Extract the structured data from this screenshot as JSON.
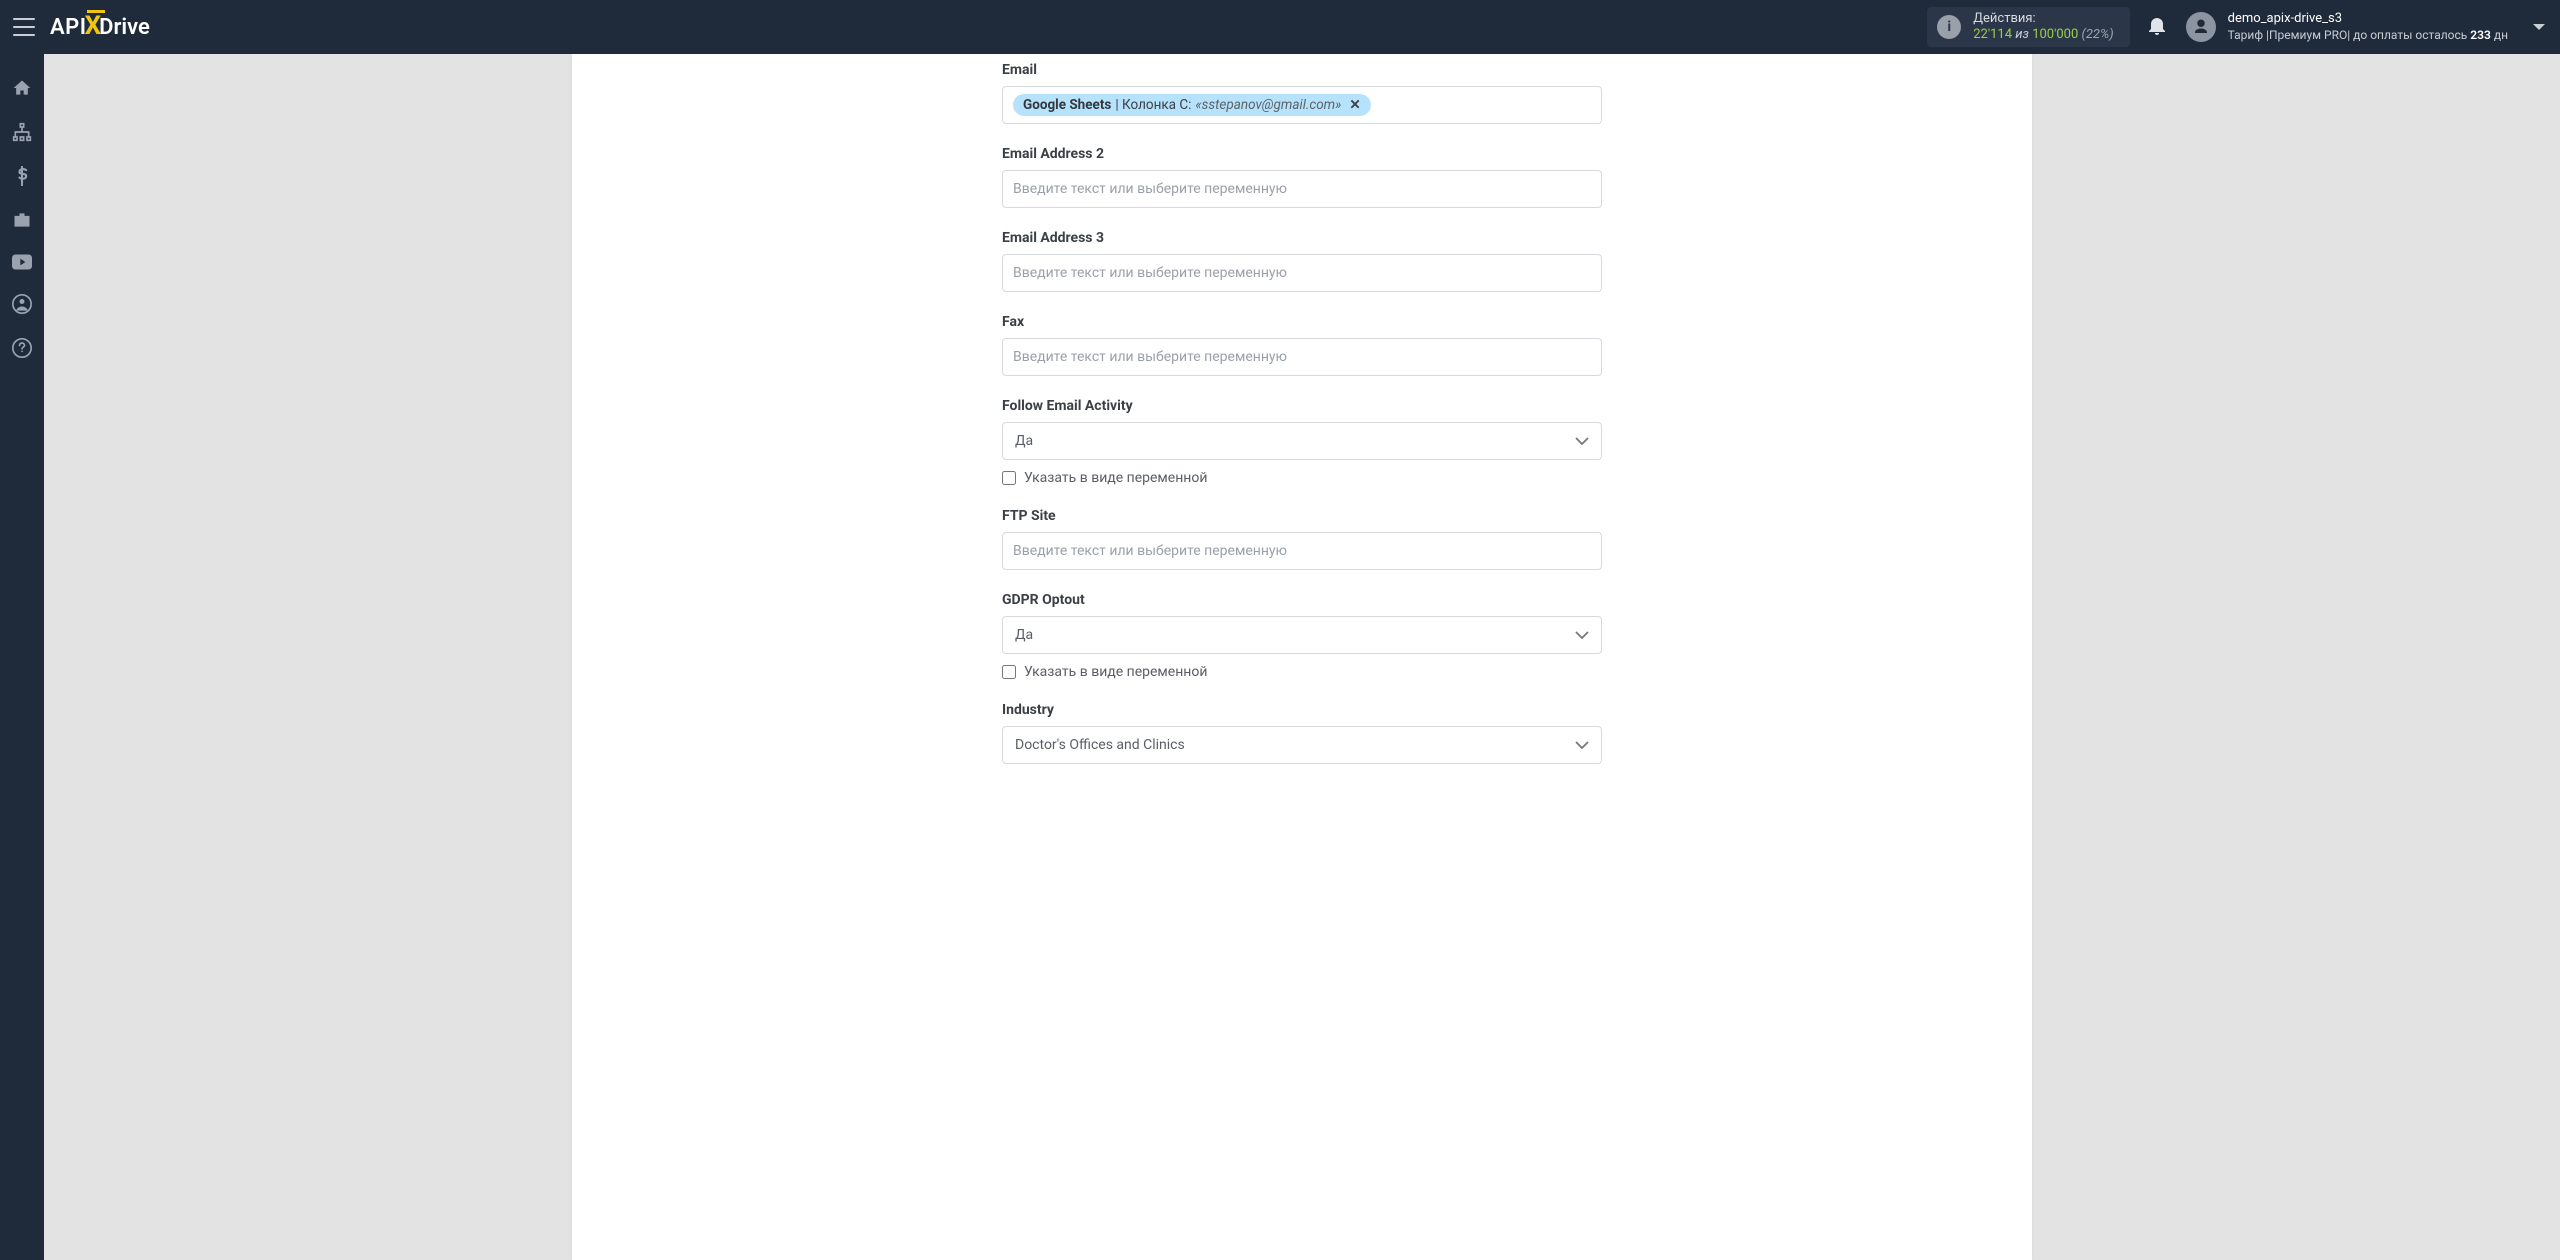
{
  "header": {
    "logo_api": "API",
    "logo_drive": "Drive",
    "actions": {
      "label": "Действия:",
      "used": "22'114",
      "of_word": "из",
      "total": "100'000",
      "pct": "(22%)"
    },
    "user": {
      "name": "demo_apix-drive_s3",
      "sub_prefix": "Тариф |Премиум PRO| до оплаты осталось ",
      "days": "233",
      "sub_suffix": " дн"
    }
  },
  "fields": {
    "email": {
      "label": "Email",
      "chip_source": "Google Sheets",
      "chip_col": " | Колонка C: ",
      "chip_value": "«sstepanov@gmail.com»"
    },
    "email2": {
      "label": "Email Address 2",
      "placeholder": "Введите текст или выберите переменную"
    },
    "email3": {
      "label": "Email Address 3",
      "placeholder": "Введите текст или выберите переменную"
    },
    "fax": {
      "label": "Fax",
      "placeholder": "Введите текст или выберите переменную"
    },
    "follow": {
      "label": "Follow Email Activity",
      "value": "Да",
      "as_var": "Указать в виде переменной"
    },
    "ftp": {
      "label": "FTP Site",
      "placeholder": "Введите текст или выберите переменную"
    },
    "gdpr": {
      "label": "GDPR Optout",
      "value": "Да",
      "as_var": "Указать в виде переменной"
    },
    "industry": {
      "label": "Industry",
      "value": "Doctor's Offices and Clinics"
    }
  }
}
